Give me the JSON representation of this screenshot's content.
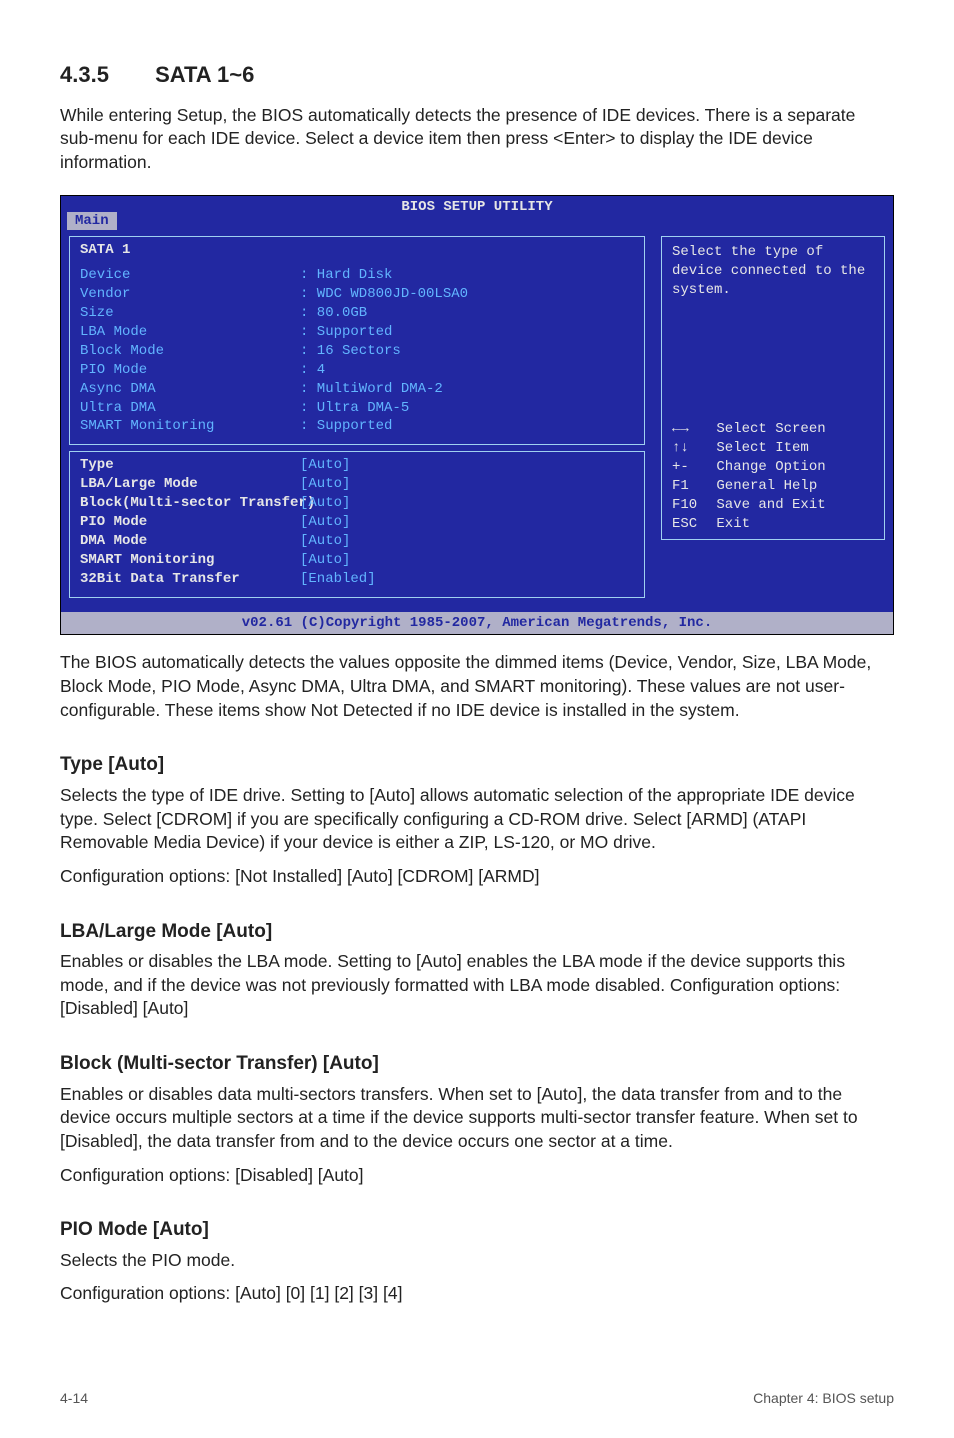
{
  "section": {
    "num": "4.3.5",
    "title": "SATA 1~6"
  },
  "intro": "While entering Setup, the BIOS automatically detects the presence of IDE devices. There is a separate sub-menu for each IDE device. Select a device item then press <Enter> to display the IDE device information.",
  "bios": {
    "title": "BIOS SETUP UTILITY",
    "tab": "Main",
    "panel_title": "SATA 1",
    "info_rows": [
      {
        "label": "Device",
        "val": ": Hard Disk"
      },
      {
        "label": "Vendor",
        "val": ": WDC WD800JD-00LSA0"
      },
      {
        "label": "Size",
        "val": ": 80.0GB"
      },
      {
        "label": "LBA Mode",
        "val": ": Supported"
      },
      {
        "label": "Block Mode",
        "val": ": 16 Sectors"
      },
      {
        "label": "PIO Mode",
        "val": ": 4"
      },
      {
        "label": "Async DMA",
        "val": ": MultiWord DMA-2"
      },
      {
        "label": "Ultra DMA",
        "val": ": Ultra DMA-5"
      },
      {
        "label": "SMART Monitoring",
        "val": ": Supported"
      }
    ],
    "config_rows": [
      {
        "label": "Type",
        "val": "[Auto]"
      },
      {
        "label": "LBA/Large Mode",
        "val": "[Auto]"
      },
      {
        "label": "Block(Multi-sector Transfer)",
        "val": "[Auto]"
      },
      {
        "label": "PIO Mode",
        "val": "[Auto]"
      },
      {
        "label": "DMA Mode",
        "val": "[Auto]"
      },
      {
        "label": "SMART Monitoring",
        "val": "[Auto]"
      },
      {
        "label": "32Bit Data Transfer",
        "val": "[Enabled]"
      }
    ],
    "help_text": "Select the type of device connected to the system.",
    "footkeys": [
      {
        "key": "←→",
        "label": "Select Screen"
      },
      {
        "key": "↑↓",
        "label": "Select Item"
      },
      {
        "key": "+-",
        "label": "Change Option"
      },
      {
        "key": "F1",
        "label": "General Help"
      },
      {
        "key": "F10",
        "label": "Save and Exit"
      },
      {
        "key": "ESC",
        "label": "Exit"
      }
    ],
    "footer": "v02.61 (C)Copyright 1985-2007, American Megatrends, Inc."
  },
  "after_bios": "The BIOS automatically detects the values opposite the dimmed items (Device, Vendor, Size, LBA Mode, Block Mode, PIO Mode, Async DMA, Ultra DMA, and SMART monitoring). These values are not user-configurable. These items show Not Detected if no IDE device is installed in the system.",
  "type_h": "Type [Auto]",
  "type_p1": "Selects the type of IDE drive. Setting to [Auto] allows automatic selection of the appropriate IDE device type. Select [CDROM] if you are specifically configuring a CD-ROM drive. Select [ARMD] (ATAPI Removable Media Device) if your device is either a ZIP, LS-120, or MO drive.",
  "type_p2": "Configuration options: [Not Installed] [Auto] [CDROM] [ARMD]",
  "lba_h": "LBA/Large Mode [Auto]",
  "lba_p": "Enables or disables the LBA mode. Setting to [Auto] enables the LBA mode if the device supports this mode, and if the device was not previously formatted with LBA mode disabled. Configuration options: [Disabled] [Auto]",
  "block_h": "Block (Multi-sector Transfer) [Auto]",
  "block_p1": "Enables or disables data multi-sectors transfers. When set to [Auto], the data transfer from and to the device occurs multiple sectors at a time if the device supports multi-sector transfer feature. When set to [Disabled], the data transfer from and to the device occurs one sector at a time.",
  "block_p2": "Configuration options: [Disabled] [Auto]",
  "pio_h": "PIO Mode [Auto]",
  "pio_p1": "Selects the PIO mode.",
  "pio_p2": "Configuration options: [Auto] [0] [1] [2] [3] [4]",
  "footer": {
    "left": "4-14",
    "right": "Chapter 4: BIOS setup"
  }
}
